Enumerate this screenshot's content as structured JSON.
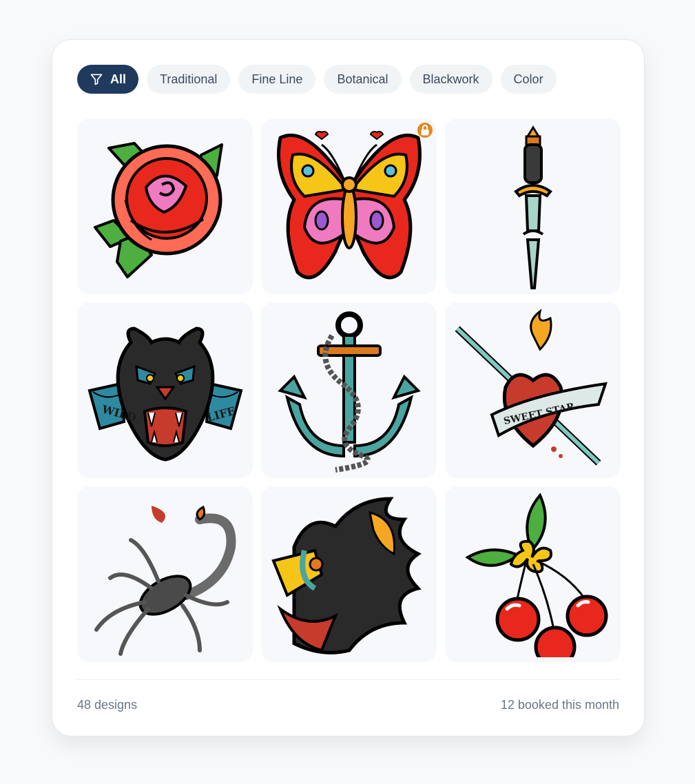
{
  "filters": [
    {
      "label": "All",
      "active": true,
      "icon": "filter-icon"
    },
    {
      "label": "Traditional",
      "active": false
    },
    {
      "label": "Fine Line",
      "active": false
    },
    {
      "label": "Botanical",
      "active": false
    },
    {
      "label": "Blackwork",
      "active": false
    },
    {
      "label": "Color",
      "active": false
    }
  ],
  "gallery": {
    "tiles": [
      {
        "subject": "rose-icon"
      },
      {
        "subject": "butterfly-icon",
        "badge": "lock-icon"
      },
      {
        "subject": "dagger-icon"
      },
      {
        "subject": "panther-icon",
        "banner_left": "WILD",
        "banner_right": "LIFE"
      },
      {
        "subject": "anchor-icon"
      },
      {
        "subject": "sacred-heart-icon",
        "banner": "SWEET STAR"
      },
      {
        "subject": "scorpion-icon"
      },
      {
        "subject": "wolf-icon"
      },
      {
        "subject": "cherries-icon"
      }
    ]
  },
  "footer": {
    "count": "48 designs",
    "booked": "12 booked this month"
  },
  "colors": {
    "active_chip": "#1f3a5c",
    "chip_bg": "#f1f4f7",
    "tile_bg": "#f6f8fb",
    "lock_badge": "#e38a1e"
  }
}
